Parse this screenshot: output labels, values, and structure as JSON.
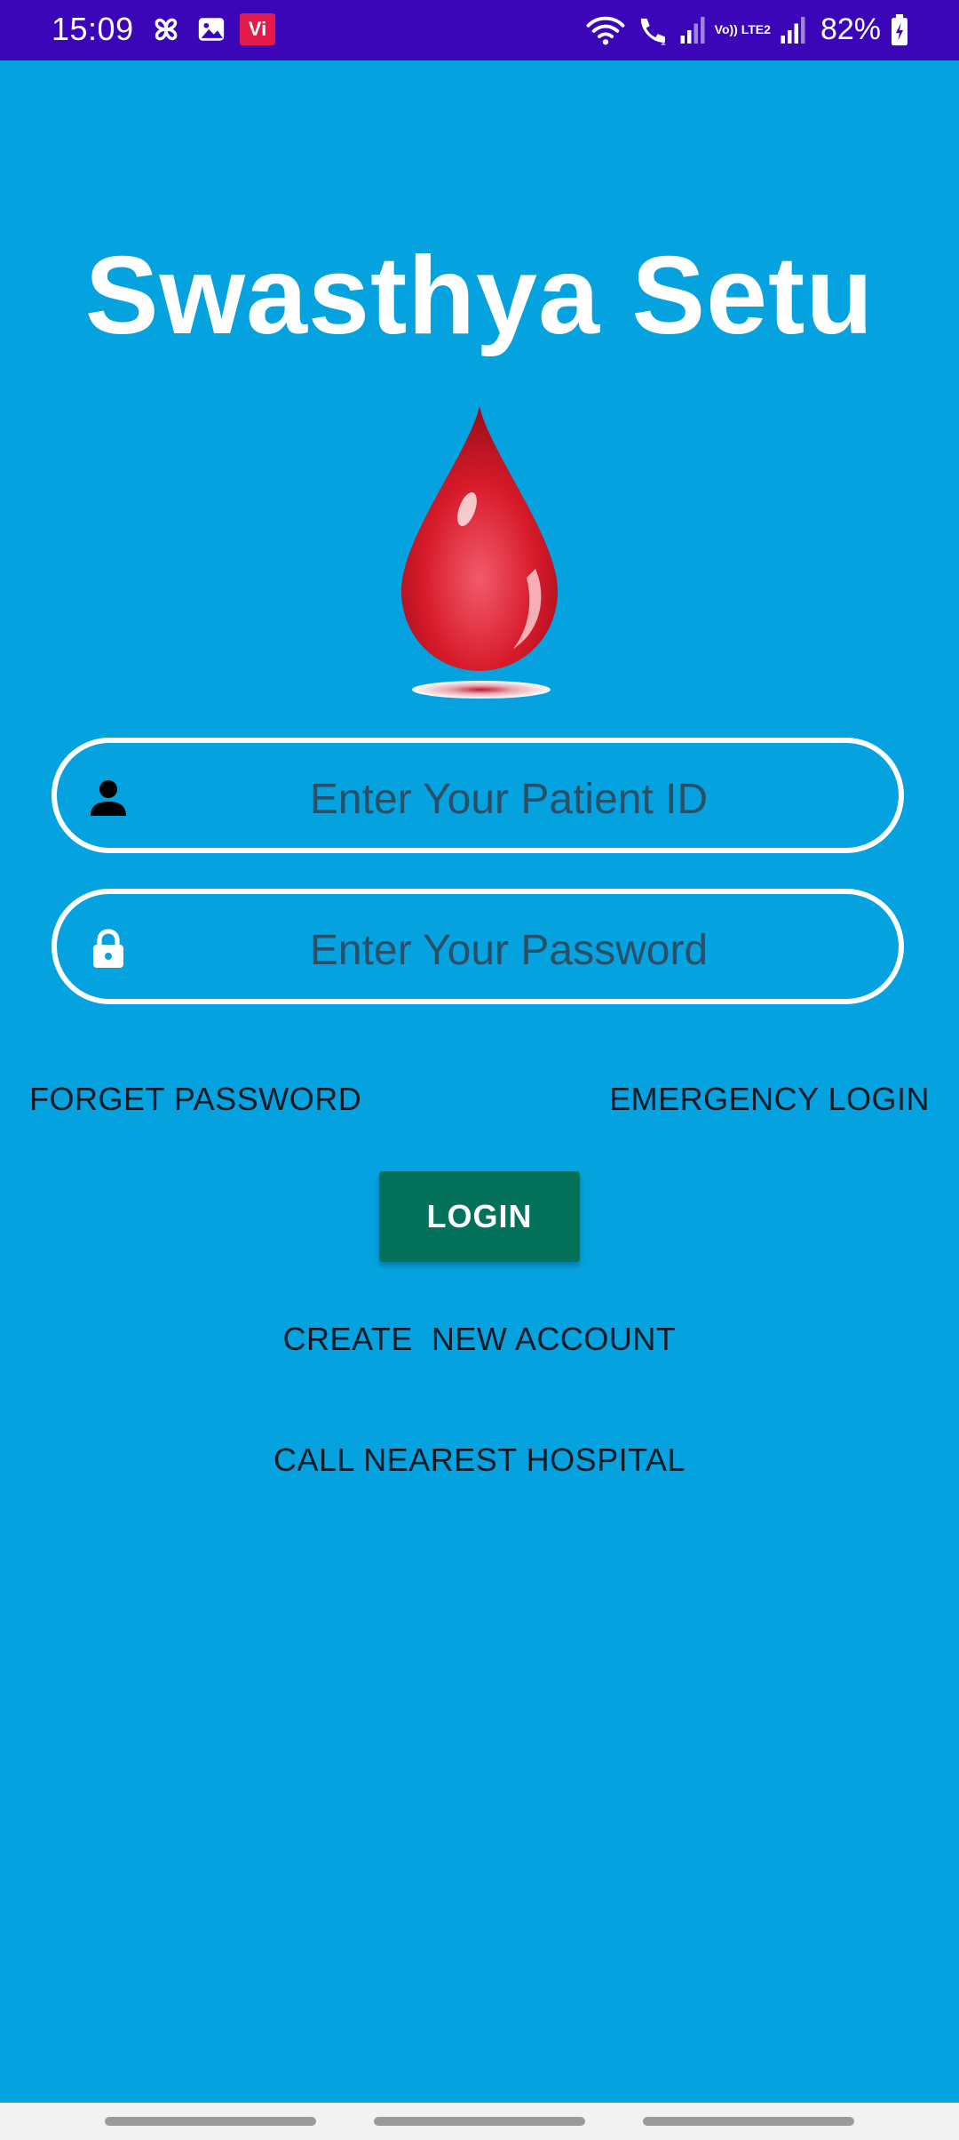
{
  "status_bar": {
    "time": "15:09",
    "carrier_badge": "Vi",
    "volte_label": "Vo)) LTE2",
    "battery_percent": "82%",
    "icons": [
      "pinwheel-icon",
      "gallery-icon",
      "vi-badge",
      "wifi-icon",
      "wifi-calling-icon",
      "signal-icon",
      "volte-icon",
      "signal-icon",
      "battery-charging-icon"
    ]
  },
  "app": {
    "title": "Swasthya Setu",
    "logo_icon": "blood-drop-icon"
  },
  "form": {
    "patient_id_placeholder": "Enter Your Patient ID",
    "patient_id_icon": "person-icon",
    "password_placeholder": "Enter Your Password",
    "password_icon": "lock-icon"
  },
  "links": {
    "forget_password": "FORGET PASSWORD",
    "emergency_login": "EMERGENCY LOGIN",
    "create_account": "CREATE  NEW ACCOUNT",
    "call_hospital": "CALL NEAREST HOSPITAL"
  },
  "buttons": {
    "login": "LOGIN"
  },
  "colors": {
    "background": "#04a3e0",
    "status_bar": "#3a06b8",
    "login_button": "#04725a",
    "drop_red": "#e2212f"
  }
}
